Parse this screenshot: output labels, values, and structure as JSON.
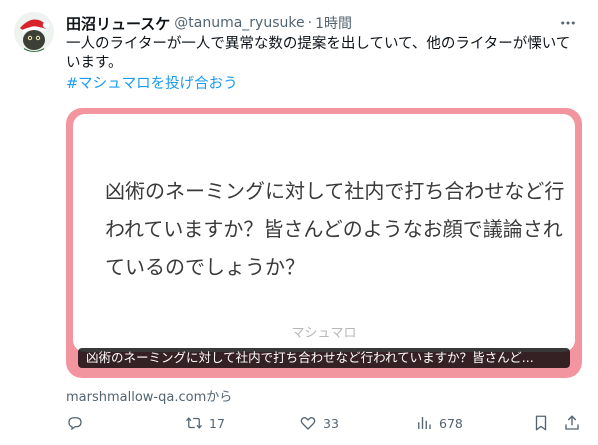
{
  "post": {
    "author_name": "田沼リュースケ",
    "handle": "@tanuma_ryusuke",
    "separator": "·",
    "time": "1時間",
    "text": "一人のライターが一人で異常な数の提案を出していて、他のライターが慄いています。",
    "hashtag": "#マシュマロを投げ合おう"
  },
  "card": {
    "question": "凶術のネーミングに対して社内で打ち合わせなど行われていますか？皆さんどのようなお顔で議論されているのでしょうか？",
    "brand": "マシュマロ",
    "caption": "凶術のネーミングに対して社内で打ち合わせなど行われていますか？皆さんど...",
    "border_color": "#f2959f"
  },
  "source": "marshmallow-qa.comから",
  "actions": {
    "reply_count": "",
    "retweet_count": "17",
    "like_count": "33",
    "views_count": "678"
  },
  "icons": {
    "more": "more-horizontal-icon",
    "reply": "reply-icon",
    "retweet": "retweet-icon",
    "like": "heart-icon",
    "views": "views-icon",
    "bookmark": "bookmark-icon",
    "share": "share-icon"
  }
}
